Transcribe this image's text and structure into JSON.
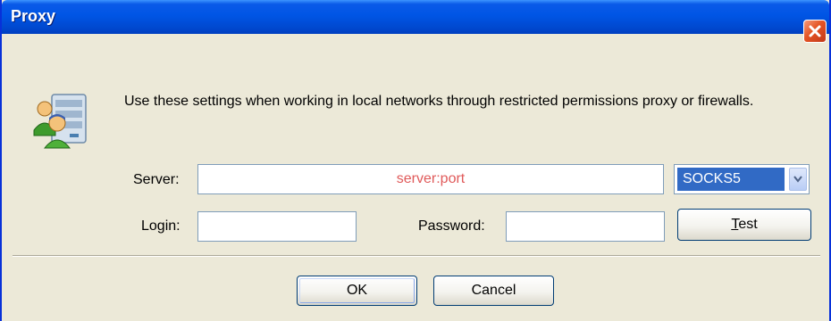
{
  "window": {
    "title": "Proxy"
  },
  "description": "Use these settings when working in local networks through restricted permissions proxy or firewalls.",
  "server": {
    "label": "Server:",
    "placeholder": "server:port",
    "value": ""
  },
  "protocol": {
    "selected": "SOCKS5"
  },
  "login": {
    "label": "Login:",
    "value": ""
  },
  "password": {
    "label": "Password:",
    "value": ""
  },
  "buttons": {
    "test_prefix": "",
    "test_access_key": "T",
    "test_rest": "est",
    "ok": "OK",
    "cancel": "Cancel"
  },
  "icons": {
    "close": "close-icon",
    "proxy": "network-users-icon",
    "dropdown": "chevron-down-icon"
  },
  "colors": {
    "titlebar": "#0055e5",
    "dialog_background": "#ece9d8",
    "placeholder": "#e05a5a",
    "selection": "#316ac5",
    "close_button": "#e45424"
  }
}
